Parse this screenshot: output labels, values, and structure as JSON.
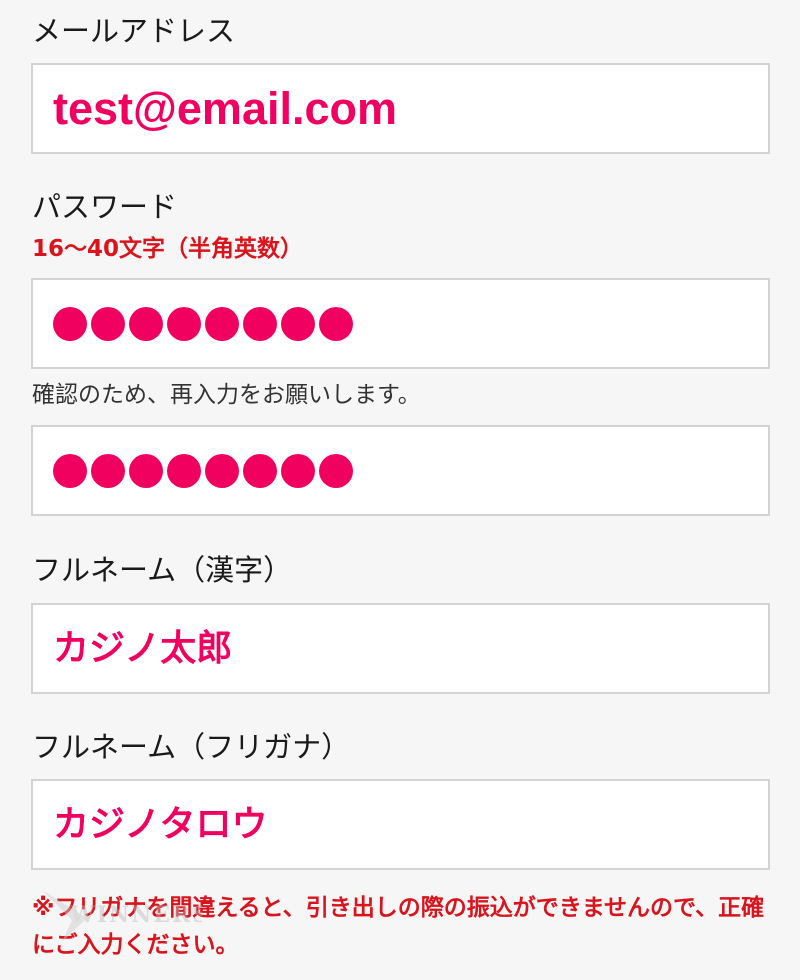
{
  "fields": {
    "email": {
      "label": "メールアドレス",
      "value": "test@email.com"
    },
    "password": {
      "label": "パスワード",
      "rule": "16～40文字（半角英数）",
      "masked_count": 8,
      "confirm_hint": "確認のため、再入力をお願いします。",
      "confirm_masked_count": 8
    },
    "fullname_kanji": {
      "label": "フルネーム（漢字）",
      "value": "カジノ太郎"
    },
    "fullname_kana": {
      "label": "フルネーム（フリガナ）",
      "value": "カジノタロウ"
    }
  },
  "notice": "※フリガナを間違えると、引き出しの際の振込ができませんので、正確にご入力ください。",
  "watermark": "WINNERS",
  "colors": {
    "input_text": "#f0005f",
    "warning_text": "#d9141d",
    "background": "#f6f6f6",
    "field_border": "#d3d3d3"
  }
}
